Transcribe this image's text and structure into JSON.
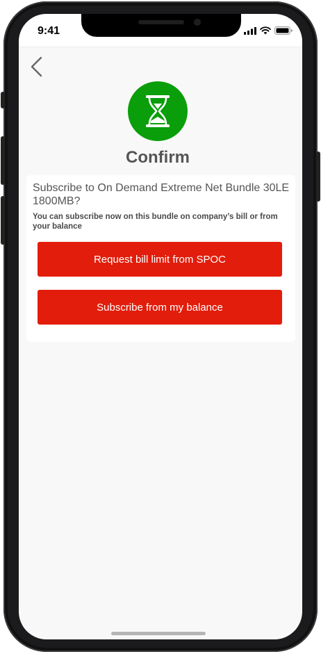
{
  "status_bar": {
    "time": "9:41"
  },
  "header": {
    "back_icon": "chevron-left-icon"
  },
  "hero": {
    "icon": "hourglass-icon",
    "title": "Confirm"
  },
  "dialog": {
    "question": "Subscribe to On Demand Extreme Net Bundle 30LE 1800MB?",
    "subtext": "You can subscribe now on this bundle on company’s bill or from your balance",
    "request_label": "Request bill limit from SPOC",
    "balance_label": "Subscribe from my balance"
  },
  "colors": {
    "accent_green": "#0a9e0a",
    "button_red": "#e21d0b",
    "title_gray": "#555555",
    "background": "#f8f8f8"
  }
}
